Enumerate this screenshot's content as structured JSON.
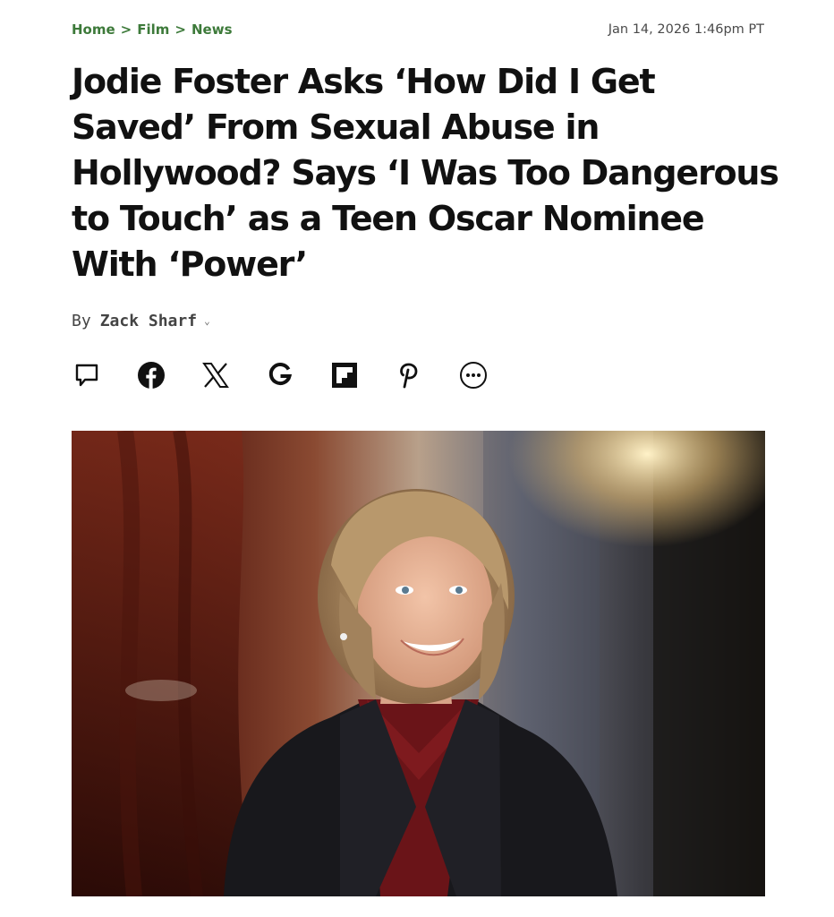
{
  "breadcrumb": {
    "items": [
      "Home",
      "Film",
      "News"
    ],
    "separator": ">"
  },
  "timestamp": "Jan 14, 2026 1:46pm PT",
  "headline": "Jodie Foster Asks ‘How Did I Get Saved’ From Sexual Abuse in Hollywood? Says ‘I Was Too Dangerous to Touch’ as a Teen Oscar Nominee With ‘Power’",
  "byline": {
    "prefix": "By",
    "author": "Zack Sharf"
  },
  "share_icons": [
    "comment-icon",
    "facebook-icon",
    "x-icon",
    "google-icon",
    "flipboard-icon",
    "pinterest-icon",
    "more-icon"
  ],
  "colors": {
    "breadcrumb": "#3d7a3a",
    "headline": "#111111",
    "byline": "#444444"
  }
}
